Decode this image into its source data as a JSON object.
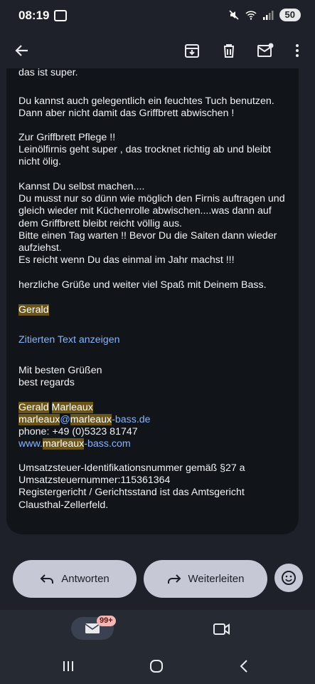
{
  "status": {
    "time": "08:19",
    "battery": "50"
  },
  "email": {
    "lines_top": "das ist super.",
    "p1": "Du kannst auch gelegentlich ein feuchtes Tuch benutzen.\nDann aber nicht damit das Griffbrett abwischen !",
    "p2": "Zur Griffbrett Pflege !!\nLeinölfirnis geht super , das trocknet richtig ab und bleibt\nnicht ölig.",
    "p3": "Kannst Du selbst machen....\nDu musst nur so dünn wie möglich den Firnis auftragen und\ngleich wieder mit Küchenrolle abwischen....was dann auf\ndem Griffbrett bleibt reicht völlig aus.\n Bitte einen Tag warten !! Bevor Du die Saiten dann wieder\naufziehst.\nEs reicht wenn Du das einmal im Jahr machst !!!",
    "p4": "herzliche Grüße und weiter viel Spaß mit Deinem Bass.",
    "signer": "Gerald",
    "show_quoted": "Zitierten Text anzeigen",
    "regards1": "Mit besten Grüßen",
    "regards2": "best regards",
    "sig_first": "Gerald",
    "sig_last": "Marleaux",
    "email_user": "marleaux",
    "email_at": "@",
    "email_domain_hl": "marleaux",
    "email_domain_rest": "-bass.de",
    "phone": "phone: +49 (0)5323 81747",
    "web_prefix": "www.",
    "web_hl": "marleaux",
    "web_rest": "-bass.com",
    "legal": "Umsatzsteuer-Identifikationsnummer gemäß §27 a\nUmsatzsteuernummer:115361364\nRegistergericht / Gerichtsstand ist das Amtsgericht\nClausthal-Zellerfeld."
  },
  "actions": {
    "reply": "Antworten",
    "forward": "Weiterleiten"
  },
  "nav": {
    "mail_badge": "99+"
  }
}
